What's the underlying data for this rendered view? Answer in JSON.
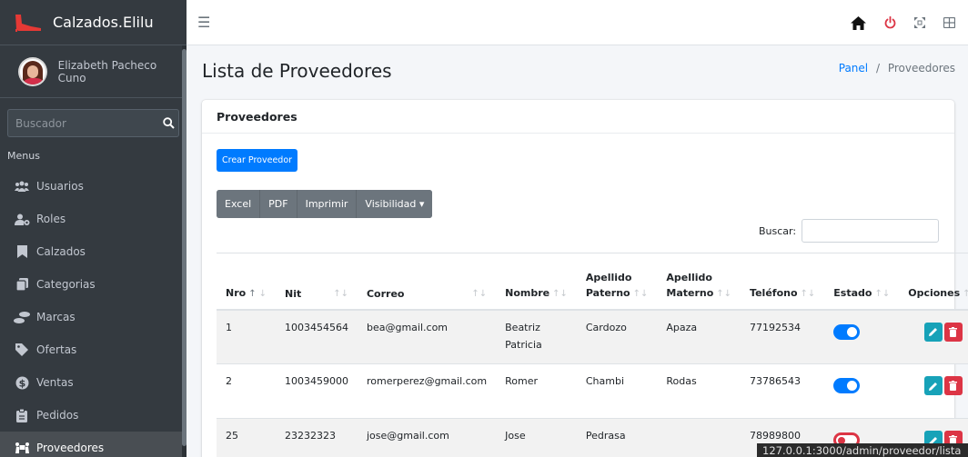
{
  "app": {
    "brand": "Calzados.Elilu",
    "user": "Elizabeth Pacheco Cuno"
  },
  "sidebar": {
    "search_placeholder": "Buscador",
    "menu_header": "Menus",
    "items": [
      {
        "label": "Usuarios",
        "icon": "users-icon"
      },
      {
        "label": "Roles",
        "icon": "user-gear-icon"
      },
      {
        "label": "Calzados",
        "icon": "bookmark-icon"
      },
      {
        "label": "Categorias",
        "icon": "copy-icon"
      },
      {
        "label": "Marcas",
        "icon": "shoe-prints-icon"
      },
      {
        "label": "Ofertas",
        "icon": "tag-icon"
      },
      {
        "label": "Ventas",
        "icon": "dollar-circle-icon"
      },
      {
        "label": "Pedidos",
        "icon": "clipboard-icon"
      },
      {
        "label": "Proveedores",
        "icon": "people-carry-icon"
      }
    ]
  },
  "page": {
    "title": "Lista de Proveedores",
    "breadcrumb": {
      "link": "Panel",
      "sep": "/",
      "current": "Proveedores"
    }
  },
  "card": {
    "header": "Proveedores",
    "create_button": "Crear Proveedor",
    "export_buttons": {
      "excel": "Excel",
      "pdf": "PDF",
      "print": "Imprimir",
      "visibility": "Visibilidad ▾"
    },
    "search_label": "Buscar:"
  },
  "table": {
    "headers": {
      "nro": "Nro",
      "nit": "Nit",
      "correo": "Correo",
      "nombre": "Nombre",
      "ap1": "Apellido",
      "ap2": "Paterno",
      "am1": "Apellido",
      "am2": "Materno",
      "telefono": "Teléfono",
      "estado": "Estado",
      "opciones": "Opciones"
    },
    "rows": [
      {
        "nro": "1",
        "nit": "1003454564",
        "correo": "bea@gmail.com",
        "nombre1": "Beatriz",
        "nombre2": "Patricia",
        "paterno": "Cardozo",
        "materno": "Apaza",
        "telefono": "77192534",
        "estado": "on"
      },
      {
        "nro": "2",
        "nit": "1003459000",
        "correo": "romerperez@gmail.com",
        "nombre1": "Romer",
        "nombre2": "",
        "paterno": "Chambi",
        "materno": "Rodas",
        "telefono": "73786543",
        "estado": "on"
      },
      {
        "nro": "25",
        "nit": "23232323",
        "correo": "jose@gmail.com",
        "nombre1": "Jose",
        "nombre2": "",
        "paterno": "Pedrasa",
        "materno": "",
        "telefono": "78989800",
        "estado": "off"
      }
    ]
  },
  "status_url": "127.0.0.1:3000/admin/proveedor/lista",
  "colors": {
    "sidebar": "#343a40",
    "primary": "#007bff",
    "info": "#17a2b8",
    "danger": "#dc3545"
  }
}
